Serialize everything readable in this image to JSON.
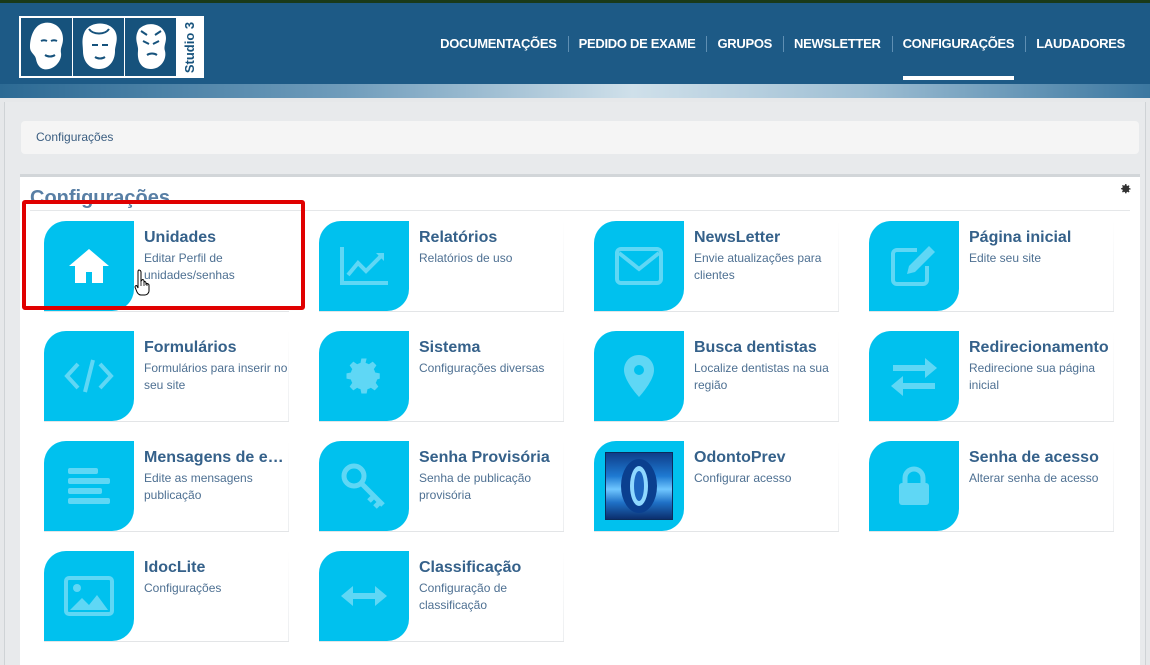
{
  "brand": {
    "logo_text": "Studio 3"
  },
  "nav": {
    "items": [
      {
        "id": "documentacoes",
        "label": "DOCUMENTAÇÕES"
      },
      {
        "id": "pedido",
        "label": "PEDIDO DE EXAME"
      },
      {
        "id": "grupos",
        "label": "GRUPOS"
      },
      {
        "id": "newsletter",
        "label": "NEWSLETTER"
      },
      {
        "id": "configuracoes",
        "label": "CONFIGURAÇÕES",
        "active": true
      },
      {
        "id": "laudadores",
        "label": "LAUDADORES"
      }
    ]
  },
  "breadcrumb": {
    "current": "Configurações"
  },
  "panel": {
    "title": "Configurações",
    "settings_icon": "gear-icon"
  },
  "cards": [
    {
      "icon": "home-icon",
      "title": "Unidades",
      "desc": "Editar Perfil de unidades/senhas"
    },
    {
      "icon": "chart-line-icon",
      "title": "Relatórios",
      "desc": "Relatórios de uso"
    },
    {
      "icon": "envelope-icon",
      "title": "NewsLetter",
      "desc": "Envie atualizações para clientes"
    },
    {
      "icon": "edit-icon",
      "title": "Página inicial",
      "desc": "Edite seu site"
    },
    {
      "icon": "code-icon",
      "title": "Formulários",
      "desc": "Formulários para inserir no seu site"
    },
    {
      "icon": "gear-icon",
      "title": "Sistema",
      "desc": "Configurações diversas"
    },
    {
      "icon": "map-pin-icon",
      "title": "Busca dentistas",
      "desc": "Localize dentistas na sua região"
    },
    {
      "icon": "exchange-icon",
      "title": "Redirecionamento",
      "desc": "Redirecione sua página inicial"
    },
    {
      "icon": "list-lines-icon",
      "title": "Mensagens de e…",
      "desc": "Edite as mensagens publicação"
    },
    {
      "icon": "key-icon",
      "title": "Senha Provisória",
      "desc": "Senha de publicação provisória"
    },
    {
      "icon": "odontoprev-logo",
      "title": "OdontoPrev",
      "desc": "Configurar acesso"
    },
    {
      "icon": "lock-icon",
      "title": "Senha de acesso",
      "desc": "Alterar senha de acesso"
    },
    {
      "icon": "image-icon",
      "title": "IdocLite",
      "desc": "Configurações"
    },
    {
      "icon": "arrows-horizontal-icon",
      "title": "Classificação",
      "desc": "Configuração de classificação"
    }
  ],
  "colors": {
    "header": "#1d5a86",
    "tile": "#00c1ee",
    "highlight": "#e00000",
    "title_text": "#35618a"
  }
}
